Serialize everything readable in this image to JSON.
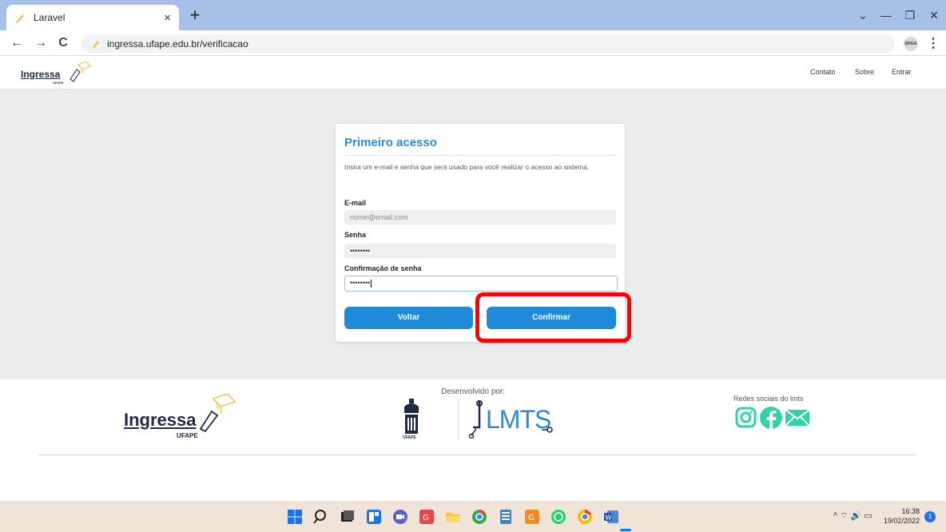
{
  "browser": {
    "tab_title": "Laravel",
    "tab_close": "×",
    "new_tab": "+",
    "url": "ingressa.ufape.edu.br/verificacao",
    "profile_label": "DRGA",
    "menu": "⋮",
    "back": "←",
    "forward": "→",
    "reload": "C",
    "minimize": "—",
    "restore": "❐",
    "close": "✕",
    "tab_list": "⌄"
  },
  "header": {
    "logo_text": "Ingressa",
    "logo_sub": "UFAPE",
    "nav": [
      "Contato",
      "Sobre",
      "Entrar"
    ]
  },
  "card": {
    "title": "Primeiro acesso",
    "description": "Insira um e-mail e senha que será usado para você realizar o acesso ao sistema.",
    "email_label": "E-mail",
    "email_placeholder": "nome@email.com",
    "password_label": "Senha",
    "password_value": "••••••••",
    "confirm_label": "Confirmação de senha",
    "confirm_value": "••••••••",
    "back_button": "Voltar",
    "confirm_button": "Confirmar"
  },
  "footer": {
    "logo_text": "Ingressa",
    "logo_sub": "UFAPE",
    "developed_by": "Desenvolvido por:",
    "lmts_text": "LMTS",
    "ufape_seal_text": "UFAPE",
    "social_label": "Redes sociais do lmts"
  },
  "taskbar": {
    "time": "16:38",
    "date": "19/02/2022",
    "notifications": "1",
    "tray": "^ ⌔ 🔊 ▭"
  },
  "colors": {
    "accent": "#1f8ad8",
    "title_blue": "#2b8ad6",
    "highlight": "#ff0000",
    "social_green": "#2ed3a6"
  }
}
